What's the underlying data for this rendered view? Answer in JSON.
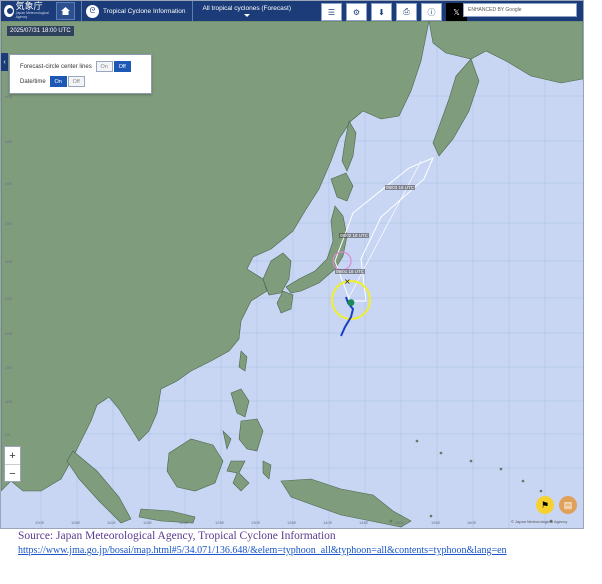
{
  "header": {
    "agency_name": "気象庁",
    "agency_name_en": "Japan Meteorological Agency",
    "section_label": "Tropical Cyclone Information",
    "cyclone_selector": "All tropical cyclones (Forecast)",
    "search_placeholder": "ENHANCED BY Google",
    "icons": [
      "home-icon",
      "typhoon-icon",
      "layers-icon",
      "settings-icon",
      "download-icon",
      "print-icon",
      "info-icon",
      "x-icon",
      "search-icon"
    ]
  },
  "map": {
    "timestamp": "2025/07/31 18:00 UTC",
    "lat_labels": [
      "50N",
      "45N",
      "40N",
      "35N",
      "30N",
      "25N",
      "20N",
      "15N",
      "10N",
      "5N",
      "0"
    ],
    "lon_labels": [
      "100E",
      "105E",
      "110E",
      "115E",
      "120E",
      "125E",
      "130E",
      "135E",
      "140E",
      "145E",
      "150E",
      "155E",
      "160E",
      "165E",
      "170E",
      "175E",
      "180"
    ],
    "forecast_labels": [
      "08/03 18 UTC",
      "08/02 18 UTC",
      "08/01 18 UTC"
    ],
    "copyright": "© Japan Meteorological Agency",
    "colors": {
      "sea": "#c8d6f3",
      "land": "#7f9c7c",
      "coast": "#4b6650",
      "track": "#1a3fc4",
      "forecast_line": "#ffffff",
      "storm_circle": "#f2ef2a",
      "forecast_circle": "#d98ad6"
    }
  },
  "options_panel": {
    "rows": [
      {
        "label": "Forecast-circle center lines",
        "on": "On",
        "off": "Off",
        "selected": "Off"
      },
      {
        "label": "Date/time",
        "on": "On",
        "off": "Off",
        "selected": "On"
      }
    ]
  },
  "zoom": {
    "plus": "+",
    "minus": "−"
  },
  "caption": {
    "source": "Source: Japan Meteorological  Agency, Tropical Cyclone Information",
    "url": "https://www.jma.go.jp/bosai/map.html#5/34.071/136.648/&elem=typhoon_all&typhoon=all&contents=typhoon&lang=en"
  }
}
